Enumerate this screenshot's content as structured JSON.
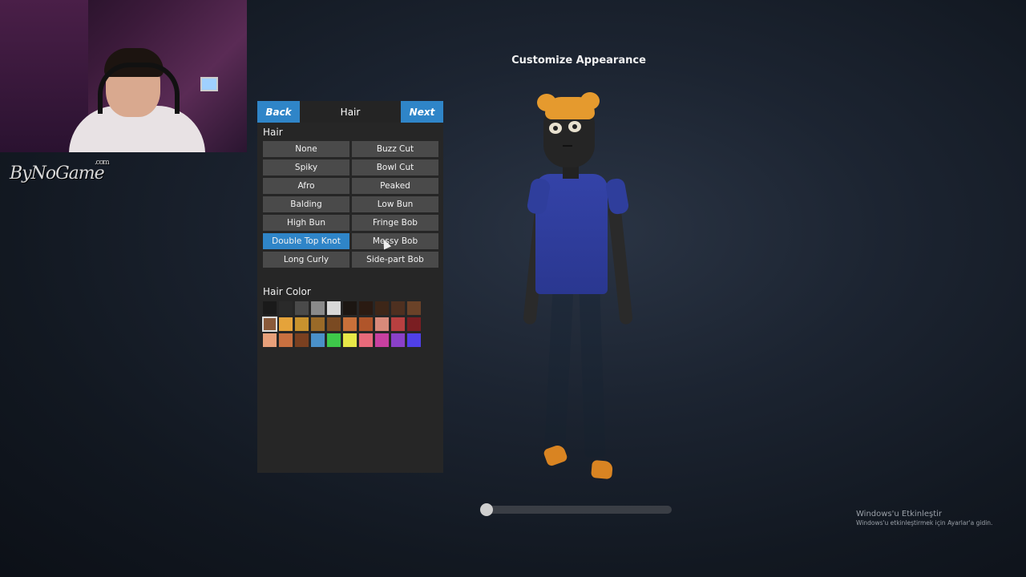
{
  "page": {
    "title": "Customize Appearance"
  },
  "watermark": {
    "brand": "ByNoGame",
    "suffix": ".com"
  },
  "panel": {
    "header": {
      "back_label": "Back",
      "title": "Hair",
      "next_label": "Next"
    },
    "hair_section_label": "Hair",
    "hair_options": [
      {
        "label": "None"
      },
      {
        "label": "Buzz Cut"
      },
      {
        "label": "Spiky"
      },
      {
        "label": "Bowl Cut"
      },
      {
        "label": "Afro"
      },
      {
        "label": "Peaked"
      },
      {
        "label": "Balding"
      },
      {
        "label": "Low Bun"
      },
      {
        "label": "High Bun"
      },
      {
        "label": "Fringe Bob"
      },
      {
        "label": "Double Top Knot",
        "selected": true
      },
      {
        "label": "Messy Bob"
      },
      {
        "label": "Long Curly"
      },
      {
        "label": "Side-part Bob"
      }
    ],
    "hair_color_label": "Hair Color",
    "hair_colors": [
      "#1a1a1a",
      "#2a2a2a",
      "#4a4a4a",
      "#8a8a8a",
      "#d8d8d8",
      "#1c1612",
      "#2a1a12",
      "#3d2618",
      "#4e3020",
      "#6a4228",
      "#8a5a3a",
      "#e5a33a",
      "#c8922e",
      "#9a6a28",
      "#7a4a22",
      "#c8703a",
      "#b0552a",
      "#d88a7a",
      "#b84040",
      "#7a1e22",
      "#e8a07a",
      "#c87040",
      "#7a4020",
      "#4a90c8",
      "#3ec84a",
      "#e8e848",
      "#e86a7a",
      "#c840a0",
      "#8a40c8",
      "#5040e8"
    ],
    "selected_color_index": 10
  },
  "rotation": {
    "value": 0.03
  },
  "activation_notice": {
    "line1": "Windows'u Etkinleştir",
    "line2": "Windows'u etkinleştirmek için Ayarlar'a gidin."
  }
}
